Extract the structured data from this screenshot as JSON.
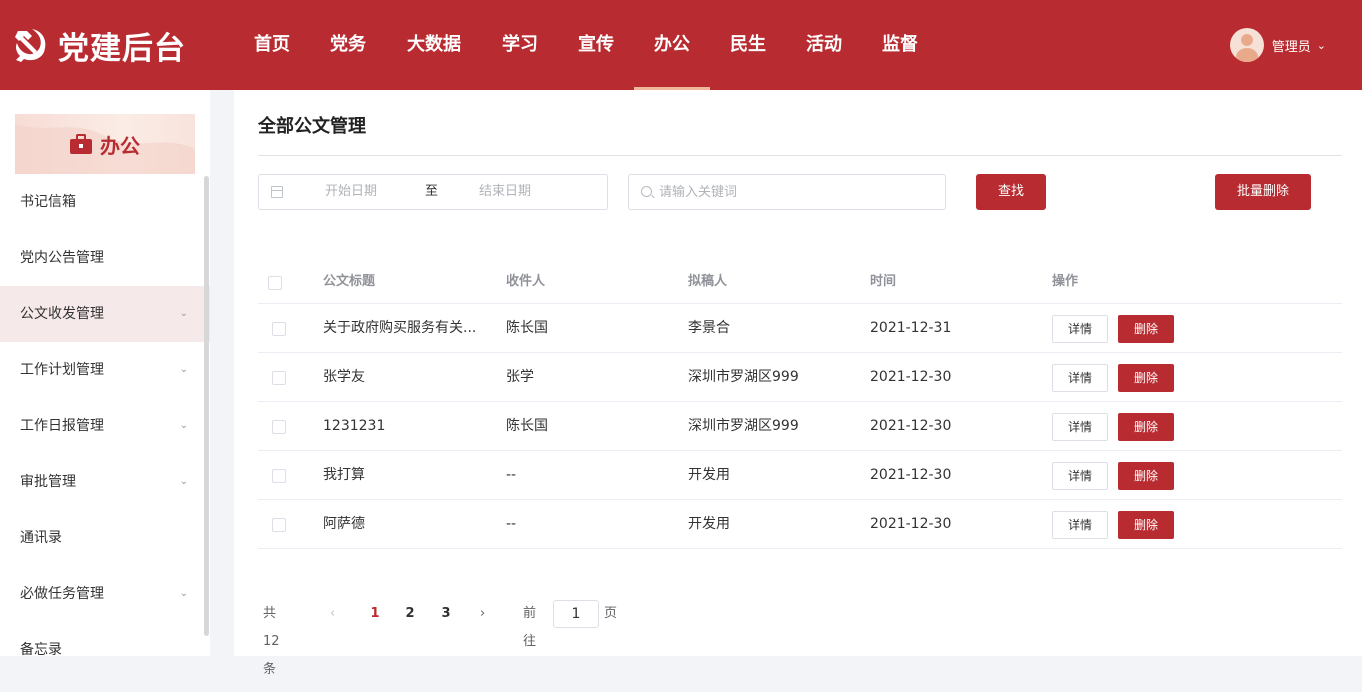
{
  "header": {
    "app_title": "党建后台",
    "nav": [
      "首页",
      "党务",
      "大数据",
      "学习",
      "宣传",
      "办公",
      "民生",
      "活动",
      "监督"
    ],
    "active_nav": "办公",
    "user_name": "管理员",
    "accent_color": "#b82b30"
  },
  "sidebar": {
    "section_title": "办公",
    "items": [
      {
        "label": "书记信箱",
        "has_arrow": false
      },
      {
        "label": "党内公告管理",
        "has_arrow": false
      },
      {
        "label": "公文收发管理",
        "has_arrow": true,
        "active": true
      },
      {
        "label": "工作计划管理",
        "has_arrow": true
      },
      {
        "label": "工作日报管理",
        "has_arrow": true
      },
      {
        "label": "审批管理",
        "has_arrow": true
      },
      {
        "label": "通讯录",
        "has_arrow": false
      },
      {
        "label": "必做任务管理",
        "has_arrow": true
      },
      {
        "label": "备忘录",
        "has_arrow": false
      }
    ]
  },
  "main": {
    "title": "全部公文管理",
    "filter": {
      "start_placeholder": "开始日期",
      "separator": "至",
      "end_placeholder": "结束日期",
      "search_placeholder": "请输入关键词",
      "find_label": "查找",
      "batch_delete_label": "批量删除"
    },
    "table": {
      "columns": [
        "公文标题",
        "收件人",
        "拟稿人",
        "时间",
        "操作"
      ],
      "detail_label": "详情",
      "delete_label": "删除",
      "rows": [
        {
          "title": "关于政府购买服务有关...",
          "recipient": "陈长国",
          "drafter": "李景合",
          "time": "2021-12-31"
        },
        {
          "title": "张学友",
          "recipient": "张学",
          "drafter": "深圳市罗湖区999",
          "time": "2021-12-30"
        },
        {
          "title": "1231231",
          "recipient": "陈长国",
          "drafter": "深圳市罗湖区999",
          "time": "2021-12-30"
        },
        {
          "title": "我打算",
          "recipient": "--",
          "drafter": "开发用",
          "time": "2021-12-30"
        },
        {
          "title": "阿萨德",
          "recipient": "--",
          "drafter": "开发用",
          "time": "2021-12-30"
        }
      ]
    },
    "pagination": {
      "total_text": "共 12 条",
      "prev": "‹",
      "pages": [
        "1",
        "2",
        "3"
      ],
      "current": "1",
      "next": "›",
      "goto_label": "前往",
      "goto_value": "1",
      "page_suffix": "页"
    }
  }
}
